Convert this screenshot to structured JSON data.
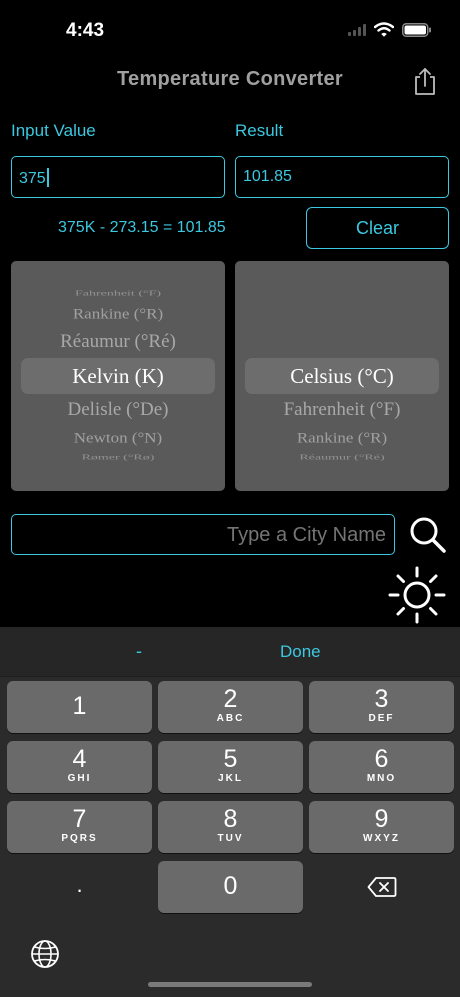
{
  "status_bar": {
    "time": "4:43"
  },
  "nav": {
    "title": "Temperature Converter"
  },
  "input": {
    "label": "Input Value",
    "value": "375"
  },
  "result": {
    "label": "Result",
    "value": "101.85"
  },
  "formula": "375K - 273.15 = 101.85",
  "clear_label": "Clear",
  "from_picker": {
    "items": [
      "Fahrenheit (°F)",
      "Rankine (°R)",
      "Réaumur (°Ré)",
      "Kelvin (K)",
      "Delisle (°De)",
      "Newton (°N)",
      "Rømer (°Rø)"
    ],
    "selected": "Kelvin (K)"
  },
  "to_picker": {
    "items": [
      "Celsius (°C)",
      "Fahrenheit (°F)",
      "Rankine (°R)",
      "Réaumur (°Ré)"
    ],
    "selected": "Celsius (°C)"
  },
  "city_search": {
    "placeholder": "Type a City Name"
  },
  "keyboard": {
    "toolbar": {
      "minus": "-",
      "done": "Done"
    },
    "keys": [
      {
        "num": "1",
        "letters": ""
      },
      {
        "num": "2",
        "letters": "ABC"
      },
      {
        "num": "3",
        "letters": "DEF"
      },
      {
        "num": "4",
        "letters": "GHI"
      },
      {
        "num": "5",
        "letters": "JKL"
      },
      {
        "num": "6",
        "letters": "MNO"
      },
      {
        "num": "7",
        "letters": "PQRS"
      },
      {
        "num": "8",
        "letters": "TUV"
      },
      {
        "num": "9",
        "letters": "WXYZ"
      },
      {
        "num": "0",
        "letters": ""
      }
    ],
    "decimal": "."
  },
  "icons": [
    "share-icon",
    "search-icon",
    "sun-icon",
    "backspace-icon",
    "globe-icon",
    "wifi-icon",
    "battery-icon",
    "signal-icon"
  ],
  "colors": {
    "accent": "#3cc8df",
    "picker_bg": "#5a5a5a",
    "keyboard_bg": "#2b2b2b",
    "key_bg": "#6a6a6a"
  }
}
